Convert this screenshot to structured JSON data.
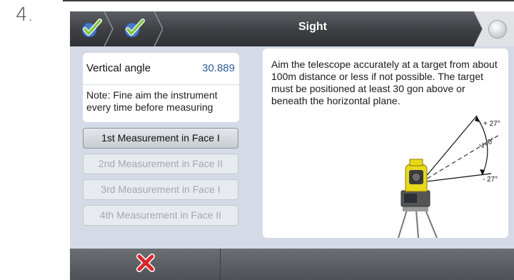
{
  "step_number": "4.",
  "header": {
    "title": "Sight",
    "breadcrumbs": [
      {
        "icon": "check-icon",
        "state": "completed"
      },
      {
        "icon": "check-icon",
        "state": "completed"
      }
    ],
    "status_indicator": "status-light-icon"
  },
  "left_panel": {
    "vertical_angle": {
      "label": "Vertical angle",
      "value": "30.889"
    },
    "note": "Note: Fine aim the instrument every time before measuring",
    "measurements": [
      {
        "label": "1st Measurement in Face I",
        "enabled": true
      },
      {
        "label": "2nd Measurement in Face II",
        "enabled": false
      },
      {
        "label": "3rd Measurement in Face I",
        "enabled": false
      },
      {
        "label": "4th Measurement in Face II",
        "enabled": false
      }
    ]
  },
  "instructions": {
    "text": "Aim the telescope accurately at a target from about 100m distance or less if not possible. The target must be positioned at least 30 gon above or beneath the horizontal plane.",
    "diagram_labels": {
      "upper": "+ 27°",
      "center": "V=0°",
      "lower": "- 27°"
    }
  },
  "footer": {
    "cancel_icon": "x-icon"
  },
  "colors": {
    "value": "#2f5d9a",
    "check": "#7ec63f",
    "cancel": "#d8262b",
    "panel": "#d4dbe6"
  }
}
